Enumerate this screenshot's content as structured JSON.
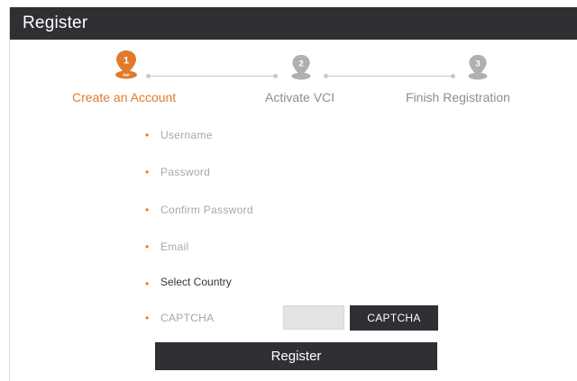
{
  "window": {
    "title": "Register"
  },
  "steps": [
    {
      "number": "1",
      "label": "Create an Account",
      "state": "active"
    },
    {
      "number": "2",
      "label": "Activate VCI",
      "state": "inactive"
    },
    {
      "number": "3",
      "label": "Finish Registration",
      "state": "inactive"
    }
  ],
  "form": {
    "username": {
      "value": "",
      "placeholder": "Username"
    },
    "password": {
      "value": "",
      "placeholder": "Password"
    },
    "confirm_password": {
      "value": "",
      "placeholder": "Confirm Password"
    },
    "email": {
      "value": "",
      "placeholder": "Email"
    },
    "country": {
      "label": "Select Country"
    },
    "captcha": {
      "value": "",
      "placeholder": "CAPTCHA",
      "button_label": "CAPTCHA"
    },
    "required_marker": "•"
  },
  "actions": {
    "register_label": "Register"
  },
  "colors": {
    "accent": "#e07b2e",
    "inactive_step": "#b0b0b0",
    "dark": "#2f3033"
  }
}
